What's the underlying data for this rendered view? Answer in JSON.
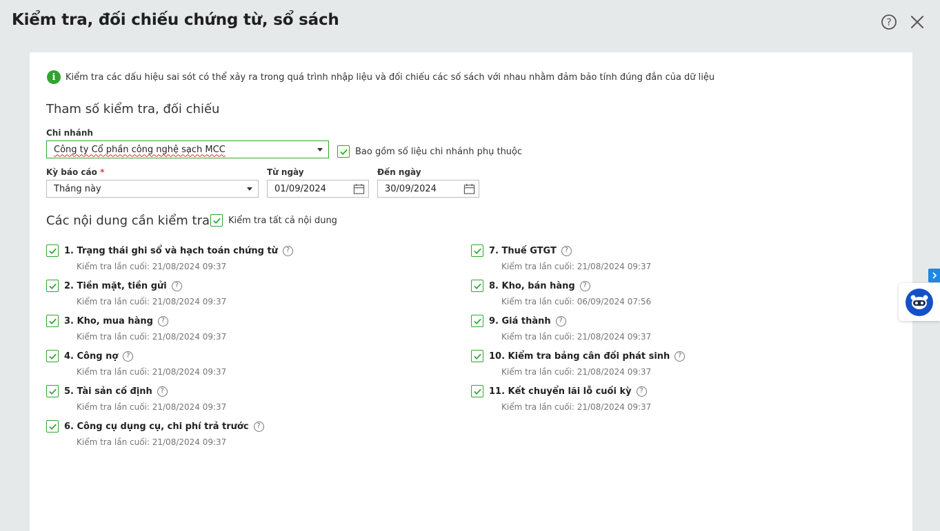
{
  "window": {
    "title": "Kiểm tra, đối chiếu chứng từ, sổ sách"
  },
  "info": {
    "text": "Kiểm tra các dấu hiệu sai sót có thể xảy ra trong quá trình nhập liệu và đối chiếu các số sách với nhau nhằm đảm bảo tính đúng đắn của dữ liệu"
  },
  "params": {
    "section_title": "Tham số kiểm tra, đối chiếu",
    "branch_label": "Chi nhánh",
    "branch_value": "Công ty Cổ phần công nghệ sạch MCC",
    "include_sub_label": "Bao gồm số liệu chi nhánh phụ thuộc",
    "period_label": "Kỳ báo cáo",
    "required_mark": "*",
    "period_value": "Tháng này",
    "from_label": "Từ ngày",
    "from_value": "01/09/2024",
    "to_label": "Đến ngày",
    "to_value": "30/09/2024"
  },
  "content": {
    "section_title": "Các nội dung cần kiểm tra",
    "check_all_label": "Kiểm tra tất cả nội dung",
    "help_glyph": "?",
    "items": [
      {
        "label": "1. Trạng thái ghi sổ và hạch toán chứng từ",
        "last": "Kiểm tra lần cuối: 21/08/2024 09:37"
      },
      {
        "label": "2. Tiền mặt, tiền gửi",
        "last": "Kiểm tra lần cuối: 21/08/2024 09:37"
      },
      {
        "label": "3. Kho, mua hàng",
        "last": "Kiểm tra lần cuối: 21/08/2024 09:37"
      },
      {
        "label": "4. Công nợ",
        "last": "Kiểm tra lần cuối: 21/08/2024 09:37"
      },
      {
        "label": "5. Tài sản cố định",
        "last": "Kiểm tra lần cuối: 21/08/2024 09:37"
      },
      {
        "label": "6. Công cụ dụng cụ, chi phí trả trước",
        "last": "Kiểm tra lần cuối: 21/08/2024 09:37"
      },
      {
        "label": "7. Thuế GTGT",
        "last": "Kiểm tra lần cuối: 21/08/2024 09:37"
      },
      {
        "label": "8. Kho, bán hàng",
        "last": "Kiểm tra lần cuối: 06/09/2024 07:56"
      },
      {
        "label": "9. Giá thành",
        "last": "Kiểm tra lần cuối: 21/08/2024 09:37"
      },
      {
        "label": "10. Kiểm tra bảng cân đối phát sinh",
        "last": "Kiểm tra lần cuối: 21/08/2024 09:37"
      },
      {
        "label": "11. Kết chuyển lãi lỗ cuối kỳ",
        "last": "Kiểm tra lần cuối: 21/08/2024 09:37"
      }
    ]
  },
  "colors": {
    "accent": "#2fa52f",
    "background": "#e6e9e9",
    "panel": "#ffffff",
    "side_button": "#1e88e5",
    "assistant": "#1450c8"
  },
  "icons": {
    "help": "help-circle-icon",
    "close": "close-icon",
    "info": "info-icon",
    "calendar": "calendar-icon",
    "check": "checkmark-icon",
    "assistant": "assistant-bot-icon",
    "side": "chevron-right-icon"
  }
}
